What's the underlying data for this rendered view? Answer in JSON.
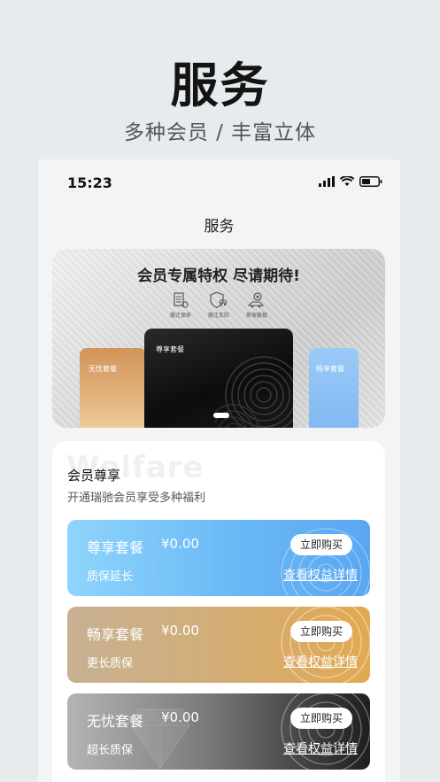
{
  "hero": {
    "title": "服务",
    "subtitle": "多种会员 / 丰富立体"
  },
  "status_bar": {
    "time": "15:23",
    "icons": [
      "signal-icon",
      "wifi-icon",
      "battery-icon"
    ]
  },
  "nav": {
    "title": "服务"
  },
  "banner": {
    "title": "会员专属特权 尽请期待!",
    "features": [
      {
        "icon": "building-icon",
        "label": "搬迁保养"
      },
      {
        "icon": "shield-car-icon",
        "label": "搬迁车险"
      },
      {
        "icon": "gear-car-icon",
        "label": "质保套餐"
      }
    ],
    "cards": {
      "gold": "无忧套餐",
      "black": "尊享套餐",
      "blue": "畅享套餐"
    }
  },
  "membership": {
    "watermark": "Welfare",
    "title": "会员尊享",
    "subtitle": "开通瑞驰会员享受多种福利",
    "packages": [
      {
        "name": "尊享套餐",
        "price": "¥0.00",
        "note": "质保延长",
        "buy_label": "立即购买",
        "detail_label": "查看权益详情",
        "color": "#6ab9f6"
      },
      {
        "name": "畅享套餐",
        "price": "¥0.00",
        "note": "更长质保",
        "buy_label": "立即购买",
        "detail_label": "查看权益详情",
        "color": "#d2ad78"
      },
      {
        "name": "无忧套餐",
        "price": "¥0.00",
        "note": "超长质保",
        "buy_label": "立即购买",
        "detail_label": "查看权益详情",
        "color": "#1e1e1e"
      }
    ]
  }
}
